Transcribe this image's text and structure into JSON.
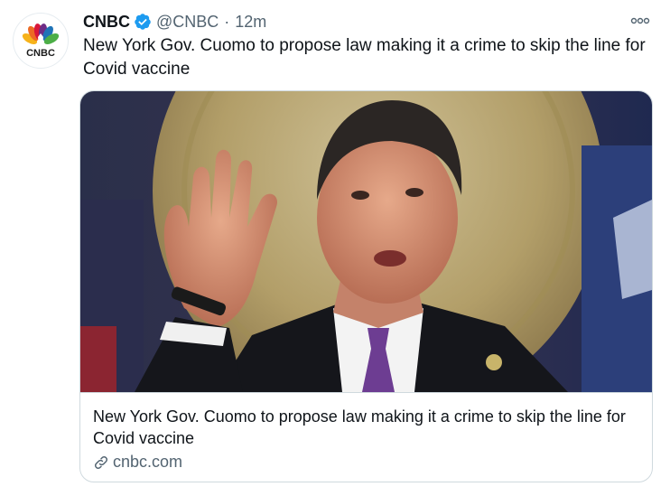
{
  "account": {
    "name": "CNBC",
    "handle": "@CNBC",
    "separator": "·",
    "time": "12m",
    "avatar_text": "CNBC"
  },
  "tweet": {
    "text": "New York Gov. Cuomo to propose law making it a crime to skip the line for Covid vaccine"
  },
  "card": {
    "title": "New York Gov. Cuomo to propose law making it a crime to skip the line for Covid vaccine",
    "domain": "cnbc.com"
  },
  "icons": {
    "verified": "verified-badge-icon",
    "more": "more-options-icon",
    "link": "link-icon"
  },
  "colors": {
    "verified_blue": "#1d9bf0",
    "secondary_text": "#536471",
    "border": "#cfd9de"
  }
}
